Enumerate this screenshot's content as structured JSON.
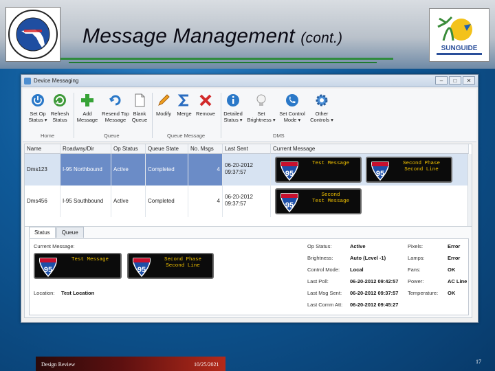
{
  "slide": {
    "title": "Message Management",
    "title_suffix": "(cont.)",
    "footer_left": "Design Review",
    "footer_date": "10/25/2021",
    "page_number": "17",
    "right_logo_text": "SUNGUIDE"
  },
  "window": {
    "title": "Device Messaging"
  },
  "ribbon": {
    "buttons": [
      {
        "label": "Set Op\nStatus ▾",
        "icon": "power-icon"
      },
      {
        "label": "Refresh\nStatus",
        "icon": "refresh-icon"
      },
      {
        "label": "Add\nMessage",
        "icon": "add-icon"
      },
      {
        "label": "Resend Top\nMessage",
        "icon": "resend-icon"
      },
      {
        "label": "Blank\nQueue",
        "icon": "blank-page-icon"
      },
      {
        "label": "Modify",
        "icon": "pencil-icon"
      },
      {
        "label": "Merge",
        "icon": "sigma-icon"
      },
      {
        "label": "Remove",
        "icon": "remove-icon"
      },
      {
        "label": "Detailed\nStatus ▾",
        "icon": "info-icon"
      },
      {
        "label": "Set\nBrightness ▾",
        "icon": "bulb-icon"
      },
      {
        "label": "Set Control\nMode ▾",
        "icon": "phone-icon"
      },
      {
        "label": "Other\nControls ▾",
        "icon": "gear-icon"
      }
    ],
    "groups": [
      "Home",
      "Queue",
      "Queue Message",
      "DMS"
    ]
  },
  "table": {
    "headers": [
      "Name",
      "Roadway/Dir",
      "Op Status",
      "Queue State",
      "No. Msgs",
      "Last Sent",
      "Current Message"
    ],
    "rows": [
      {
        "name": "Dms123",
        "roadway": "I-95 Northbound",
        "op_status": "Active",
        "queue_state": "Completed",
        "msgs": "4",
        "last_sent_date": "06-20-2012",
        "last_sent_time": "09:37:57",
        "signs": [
          {
            "route": "95",
            "line1": "Test Message",
            "line2": ""
          },
          {
            "route": "95",
            "line1": "Second Phase",
            "line2": "Second Line"
          }
        ]
      },
      {
        "name": "Dms456",
        "roadway": "I-95 Southbound",
        "op_status": "Active",
        "queue_state": "Completed",
        "msgs": "4",
        "last_sent_date": "06-20-2012",
        "last_sent_time": "09:37:57",
        "signs": [
          {
            "route": "95",
            "line1": "Second",
            "line2": "Test Message"
          }
        ]
      }
    ]
  },
  "panel": {
    "tabs": [
      "Status",
      "Queue"
    ],
    "current_message_label": "Current Message:",
    "signs": [
      {
        "route": "95",
        "line1": "Test Message",
        "line2": ""
      },
      {
        "route": "95",
        "line1": "Second Phase",
        "line2": "Second Line"
      }
    ],
    "location_label": "Location:",
    "location_value": "Test Location",
    "col1": [
      {
        "label": "Op Status:",
        "value": "Active"
      },
      {
        "label": "Brightness:",
        "value": "Auto (Level -1)"
      },
      {
        "label": "Control Mode:",
        "value": "Local"
      },
      {
        "label": "Last Poll:",
        "value": "06-20-2012 09:42:57"
      },
      {
        "label": "Last Msg Sent:",
        "value": "06-20-2012 09:37:57"
      },
      {
        "label": "Last Comm Att:",
        "value": "06-20-2012 09:45:27"
      }
    ],
    "col2": [
      {
        "label": "Pixels:",
        "value": "Error"
      },
      {
        "label": "Lamps:",
        "value": "Error"
      },
      {
        "label": "Fans:",
        "value": "OK"
      },
      {
        "label": "Power:",
        "value": "AC Line"
      },
      {
        "label": "Temperature:",
        "value": "OK"
      }
    ]
  },
  "colors": {
    "sign_text": "#f2c200",
    "selected_row": "#d7e3f2",
    "selected_cell": "#6b8cc7",
    "accent_green": "#2e8b3c"
  }
}
